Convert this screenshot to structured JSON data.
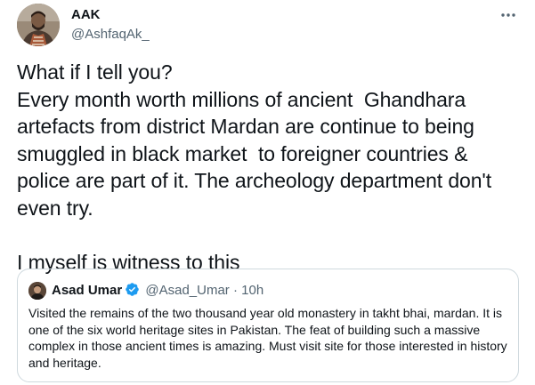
{
  "tweet": {
    "author": {
      "display_name": "AAK",
      "handle": "@AshfaqAk_"
    },
    "more_icon": "more-horizontal-icon",
    "text": "What if I tell you?\nEvery month worth millions of ancient  Ghandhara artefacts from district Mardan are continue to being smuggled in black market  to foreigner countries & police are part of it. The archeology department don't even try.\n\nI myself is witness to this"
  },
  "quoted_tweet": {
    "author": {
      "display_name": "Asad Umar",
      "handle": "@Asad_Umar",
      "verified_icon": "verified-badge-icon"
    },
    "separator": "·",
    "time": "10h",
    "text": "Visited the remains of the two thousand year old monastery in takht bhai, mardan. It is one of the six world heritage sites in Pakistan. The feat of building such a massive complex in those ancient times is amazing. Must visit site for those interested in history and heritage."
  },
  "colors": {
    "text_primary": "#0f1419",
    "text_secondary": "#536471",
    "border": "#cfd9de",
    "verified_blue": "#1d9bf0"
  }
}
